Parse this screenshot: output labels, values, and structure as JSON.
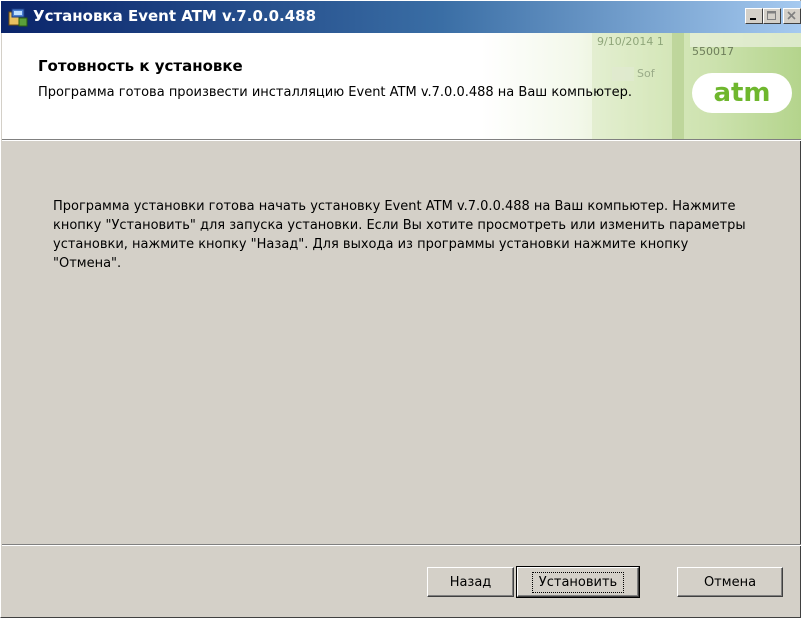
{
  "window": {
    "title": "Установка Event ATM v.7.0.0.488"
  },
  "titlebar_buttons": {
    "minimize": "minimize-icon",
    "maximize": "maximize-icon",
    "close": "close-icon"
  },
  "header": {
    "title": "Готовность к установке",
    "subtitle": "Программа готова произвести инсталляцию Event ATM v.7.0.0.488 на Ваш компьютер.",
    "logo_text": "atm",
    "logo_color": "#6fb72e",
    "deco_texts": [
      "9/10/2014 1",
      "550017",
      "Sof"
    ]
  },
  "body": {
    "text": "Программа установки готова начать установку Event ATM v.7.0.0.488 на Ваш компьютер. Нажмите кнопку \"Установить\" для запуска установки. Если Вы хотите просмотреть или изменить параметры установки, нажмите кнопку \"Назад\". Для выхода из программы установки нажмите кнопку \"Отмена\"."
  },
  "buttons": {
    "back": "Назад",
    "install": "Установить",
    "cancel": "Отмена"
  }
}
